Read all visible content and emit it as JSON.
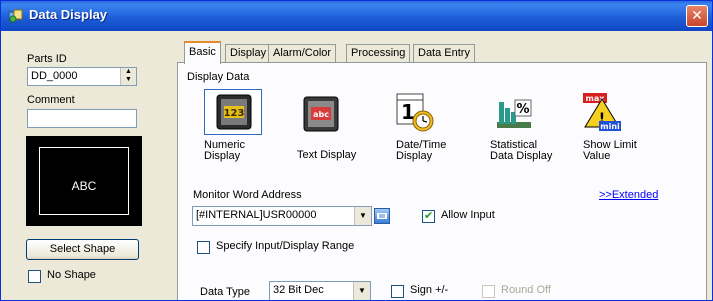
{
  "window": {
    "title": "Data Display",
    "close_icon": "close-icon"
  },
  "left": {
    "parts_id_label": "Parts ID",
    "parts_id_value": "DD_0000",
    "comment_label": "Comment",
    "comment_value": "",
    "preview_text": "ABC",
    "select_shape_label": "Select Shape",
    "no_shape_label": "No Shape",
    "no_shape_checked": false
  },
  "tabs": [
    {
      "label": "Basic",
      "active": true
    },
    {
      "label": "Display",
      "active": false
    },
    {
      "label": "Alarm/Color",
      "active": false
    },
    {
      "label": "Processing",
      "active": false
    },
    {
      "label": "Data Entry",
      "active": false
    }
  ],
  "basic": {
    "display_data_label": "Display Data",
    "display_types": [
      {
        "label_line1": "Numeric",
        "label_line2": "Display",
        "icon": "numeric-display-icon",
        "selected": true
      },
      {
        "label_line1": "Text Display",
        "label_line2": "",
        "icon": "text-display-icon",
        "selected": false
      },
      {
        "label_line1": "Date/Time",
        "label_line2": "Display",
        "icon": "datetime-display-icon",
        "selected": false
      },
      {
        "label_line1": "Statistical",
        "label_line2": "Data Display",
        "icon": "statistical-display-icon",
        "selected": false
      },
      {
        "label_line1": "Show Limit",
        "label_line2": "Value",
        "icon": "limit-value-icon",
        "selected": false
      }
    ],
    "monitor_label": "Monitor Word Address",
    "extended_link": ">>Extended",
    "monitor_value": "[#INTERNAL]USR00000",
    "allow_input_label": "Allow Input",
    "allow_input_checked": true,
    "specify_range_label": "Specify Input/Display Range",
    "specify_range_checked": false,
    "data_type_label": "Data Type",
    "data_type_value": "32 Bit Dec",
    "sign_label": "Sign +/-",
    "sign_checked": false,
    "round_off_label": "Round Off",
    "round_off_checked": false
  },
  "colors": {
    "titlebar": "#1e5ed8",
    "window_bg": "#ece9d8",
    "panel_bg": "#fcfcfe",
    "active_tab_accent": "#e68b2c",
    "link": "#0000ff"
  }
}
